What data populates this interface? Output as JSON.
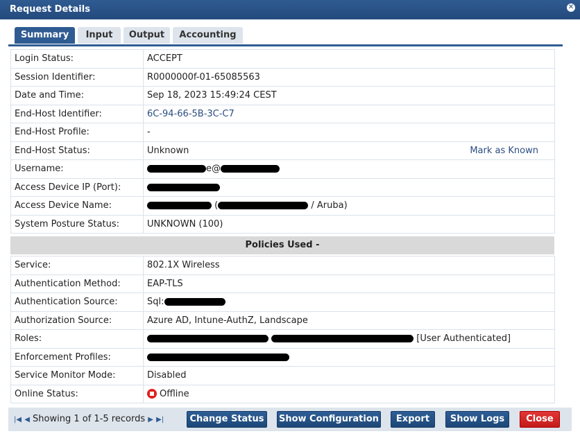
{
  "window": {
    "title": "Request Details"
  },
  "tabs": [
    {
      "label": "Summary",
      "active": true
    },
    {
      "label": "Input",
      "active": false
    },
    {
      "label": "Output",
      "active": false
    },
    {
      "label": "Accounting",
      "active": false
    }
  ],
  "summary": {
    "login_status": {
      "label": "Login Status:",
      "value": "ACCEPT"
    },
    "session_id": {
      "label": "Session Identifier:",
      "value": "R0000000f-01-65085563"
    },
    "date_time": {
      "label": "Date and Time:",
      "value": "Sep 18, 2023 15:49:24 CEST"
    },
    "endhost_id": {
      "label": "End-Host Identifier:",
      "value": "6C-94-66-5B-3C-C7"
    },
    "endhost_profile": {
      "label": "End-Host Profile:",
      "value": "-"
    },
    "endhost_status": {
      "label": "End-Host Status:",
      "value": "Unknown",
      "action": "Mark as Known"
    },
    "username": {
      "label": "Username:",
      "value_visible": "e@"
    },
    "access_device_ip": {
      "label": "Access Device IP (Port):"
    },
    "access_device_name": {
      "label": "Access Device Name:",
      "value_visible_open": "(",
      "value_visible_close": "/ Aruba)"
    },
    "posture": {
      "label": "System Posture Status:",
      "value": "UNKNOWN (100)"
    }
  },
  "policies": {
    "header": "Policies Used -",
    "service": {
      "label": "Service:",
      "value": "802.1X Wireless"
    },
    "auth_method": {
      "label": "Authentication Method:",
      "value": "EAP-TLS"
    },
    "auth_source": {
      "label": "Authentication Source:",
      "value_visible": "Sql:"
    },
    "authz_source": {
      "label": "Authorization Source:",
      "value": "Azure AD, Intune-AuthZ, Landscape"
    },
    "roles": {
      "label": "Roles:",
      "value_visible": "[User Authenticated]"
    },
    "enforcement": {
      "label": "Enforcement Profiles:"
    },
    "monitor_mode": {
      "label": "Service Monitor Mode:",
      "value": "Disabled"
    },
    "online_status": {
      "label": "Online Status:",
      "value": "Offline"
    }
  },
  "footer": {
    "pager_text": "Showing 1 of 1-5 records",
    "change_status": "Change Status",
    "show_configuration": "Show Configuration",
    "export": "Export",
    "show_logs": "Show Logs",
    "close": "Close"
  },
  "colors": {
    "accent": "#2f5b92",
    "close_button": "#d42020",
    "offline": "#e02020",
    "link": "#2a4d80"
  }
}
